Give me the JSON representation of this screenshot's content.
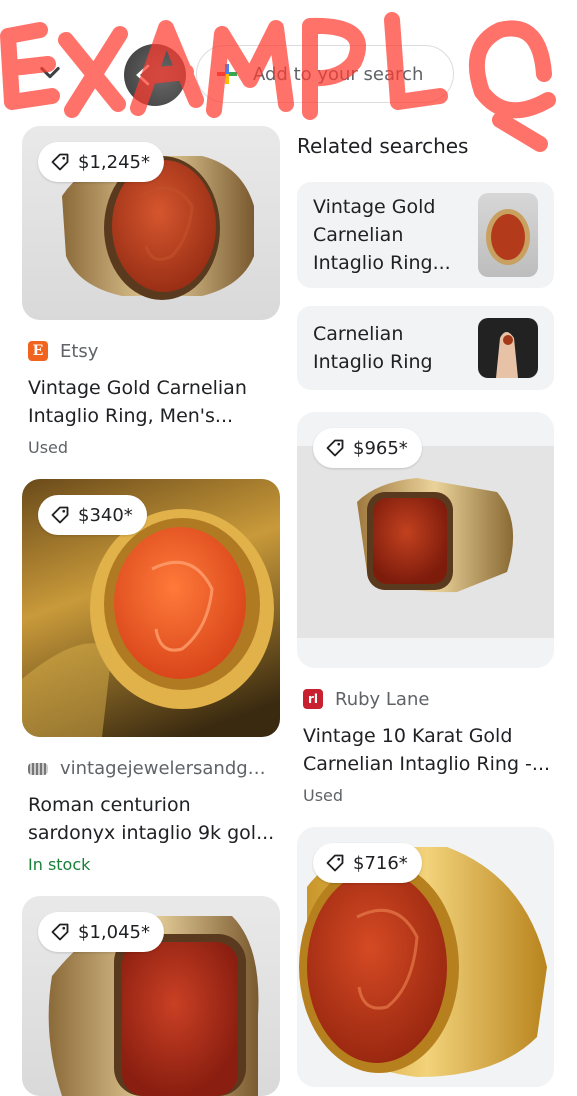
{
  "header": {
    "search_placeholder": "Add to your search",
    "watermark_text": "EXAMPLE"
  },
  "colors": {
    "google_blue": "#4285F4",
    "google_red": "#EA4335",
    "google_yellow": "#FBBC05",
    "google_green": "#34A853",
    "in_stock_green": "#188038",
    "watermark_red": "#FF3B30",
    "etsy_orange": "#F1641E",
    "ruby_lane_red": "#C8202F"
  },
  "related": {
    "heading": "Related searches",
    "items": [
      {
        "label": "Vintage Gold Carnelian Intaglio Ring..."
      },
      {
        "label": "Carnelian Intaglio Ring"
      }
    ]
  },
  "left_results": [
    {
      "price": "$1,245*",
      "source": "Etsy",
      "source_icon": "etsy-icon",
      "title": "Vintage Gold Carnelian Intaglio Ring, Men's...",
      "status": "Used"
    },
    {
      "price": "$340*",
      "source": "vintagejewelersandgift...",
      "source_icon": "vintagejewelers-icon",
      "title": "Roman centurion sardonyx intaglio 9k gol...",
      "status": "In stock"
    },
    {
      "price": "$1,045*"
    }
  ],
  "right_results": [
    {
      "price": "$965*",
      "source": "Ruby Lane",
      "source_icon": "ruby-lane-icon",
      "title": "Vintage 10 Karat Gold Carnelian Intaglio Ring -...",
      "status": "Used"
    },
    {
      "price": "$716*"
    }
  ]
}
